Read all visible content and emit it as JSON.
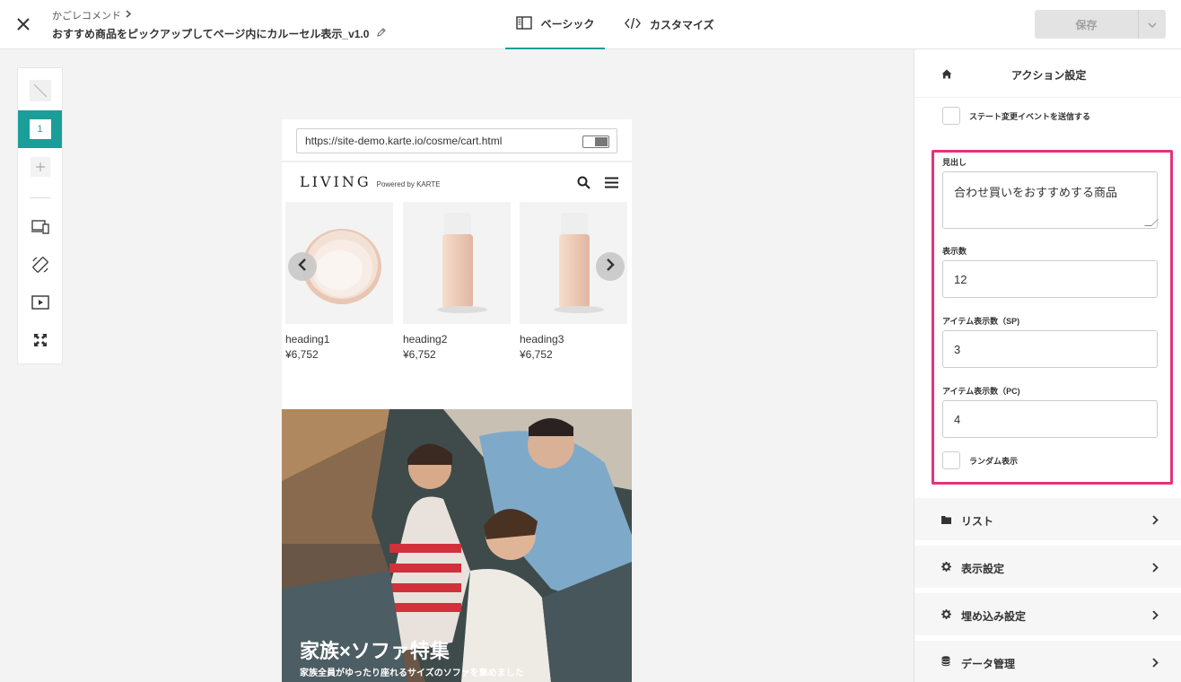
{
  "header": {
    "breadcrumb": "かごレコメンド",
    "title": "おすすめ商品をピックアップしてページ内にカルーセル表示_v1.0",
    "tabs": [
      {
        "label": "ベーシック",
        "icon": "sidebar-layout-icon",
        "active": true
      },
      {
        "label": "カスタマイズ",
        "icon": "code-icon",
        "active": false
      }
    ],
    "save_label": "保存"
  },
  "rail": {
    "active_slide": "1",
    "tools": [
      "no-slide-icon",
      "slide-1",
      "add-slide-icon",
      "device-switch-icon",
      "rotate-icon",
      "preview-play-icon",
      "fullscreen-icon"
    ]
  },
  "preview": {
    "url": "https://site-demo.karte.io/cosme/cart.html",
    "brand": "LIVING",
    "brand_sub": "Powered by KARTE",
    "products": [
      {
        "name": "heading1",
        "price": "¥6,752"
      },
      {
        "name": "heading2",
        "price": "¥6,752"
      },
      {
        "name": "heading3",
        "price": "¥6,752"
      }
    ],
    "banner_title": "家族×ソファ特集",
    "banner_sub": "家族全員がゆったり座れるサイズのソファを集めました"
  },
  "panel": {
    "title": "アクション設定",
    "state_event_label": "ステート変更イベントを送信する",
    "fields": {
      "heading_label": "見出し",
      "heading_value": "合わせ買いをおすすめする商品",
      "count_label": "表示数",
      "count_value": "12",
      "sp_label": "アイテム表示数（SP)",
      "sp_value": "3",
      "pc_label": "アイテム表示数（PC)",
      "pc_value": "4",
      "random_label": "ランダム表示"
    },
    "sections": [
      {
        "label": "リスト",
        "icon": "folder-icon"
      },
      {
        "label": "表示設定",
        "icon": "gear-icon"
      },
      {
        "label": "埋め込み設定",
        "icon": "gear-icon"
      },
      {
        "label": "データ管理",
        "icon": "database-icon"
      }
    ]
  },
  "colors": {
    "accent": "#1a9e9a",
    "highlight": "#e6327a"
  }
}
